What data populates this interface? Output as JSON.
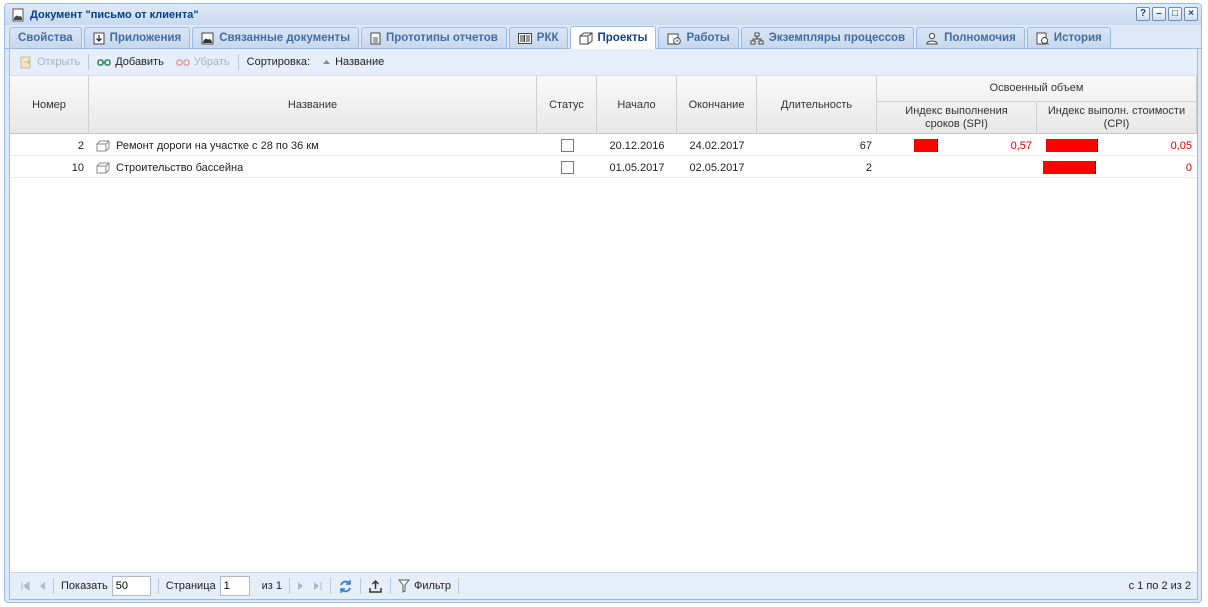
{
  "window": {
    "title": "Документ \"письмо от клиента\"",
    "buttons": [
      "?",
      "–",
      "□",
      "×"
    ]
  },
  "tabs": [
    {
      "label": "Свойства",
      "icon": "none",
      "active": false
    },
    {
      "label": "Приложения",
      "icon": "download-icon",
      "active": false
    },
    {
      "label": "Связанные документы",
      "icon": "linked-docs-icon",
      "active": false
    },
    {
      "label": "Прототипы отчетов",
      "icon": "report-icon",
      "active": false
    },
    {
      "label": "РКК",
      "icon": "barcode-icon",
      "active": false
    },
    {
      "label": "Проекты",
      "icon": "box-icon",
      "active": true
    },
    {
      "label": "Работы",
      "icon": "calendar-icon",
      "active": false
    },
    {
      "label": "Экземпляры процессов",
      "icon": "process-tree-icon",
      "active": false
    },
    {
      "label": "Полномочия",
      "icon": "user-card-icon",
      "active": false
    },
    {
      "label": "История",
      "icon": "history-icon",
      "active": false
    }
  ],
  "toolbar": {
    "open_label": "Открыть",
    "add_label": "Добавить",
    "remove_label": "Убрать",
    "sort_label": "Сортировка:",
    "sort_field": "Название"
  },
  "columns": {
    "number": "Номер",
    "name": "Название",
    "status": "Статус",
    "start": "Начало",
    "end": "Окончание",
    "duration": "Длительность",
    "earned_value_group": "Освоенный объем",
    "spi": "Индекс выполнения сроков (SPI)",
    "cpi": "Индекс выполн. стоимости (CPI)"
  },
  "rows": [
    {
      "number": "2",
      "name": "Ремонт дороги на участке с 28 по 36 км",
      "status_checked": false,
      "start": "20.12.2016",
      "end": "24.02.2017",
      "duration": "67",
      "spi": "0,57",
      "cpi": "0,05",
      "spi_bar": 0.57,
      "cpi_bar": 0.05
    },
    {
      "number": "10",
      "name": "Строительство бассейна",
      "status_checked": false,
      "start": "01.05.2017",
      "end": "02.05.2017",
      "duration": "2",
      "spi": "",
      "cpi": "0",
      "spi_bar": 0,
      "cpi_bar": 0
    }
  ],
  "pager": {
    "show_label": "Показать",
    "page_size": "50",
    "page_label": "Страница",
    "page": "1",
    "of_label": "из 1",
    "filter_label": "Фильтр",
    "info": "с 1 по 2 из 2"
  },
  "colors": {
    "bar": "#ff0000",
    "index_text": "#e00000",
    "frame": "#99bce8"
  }
}
